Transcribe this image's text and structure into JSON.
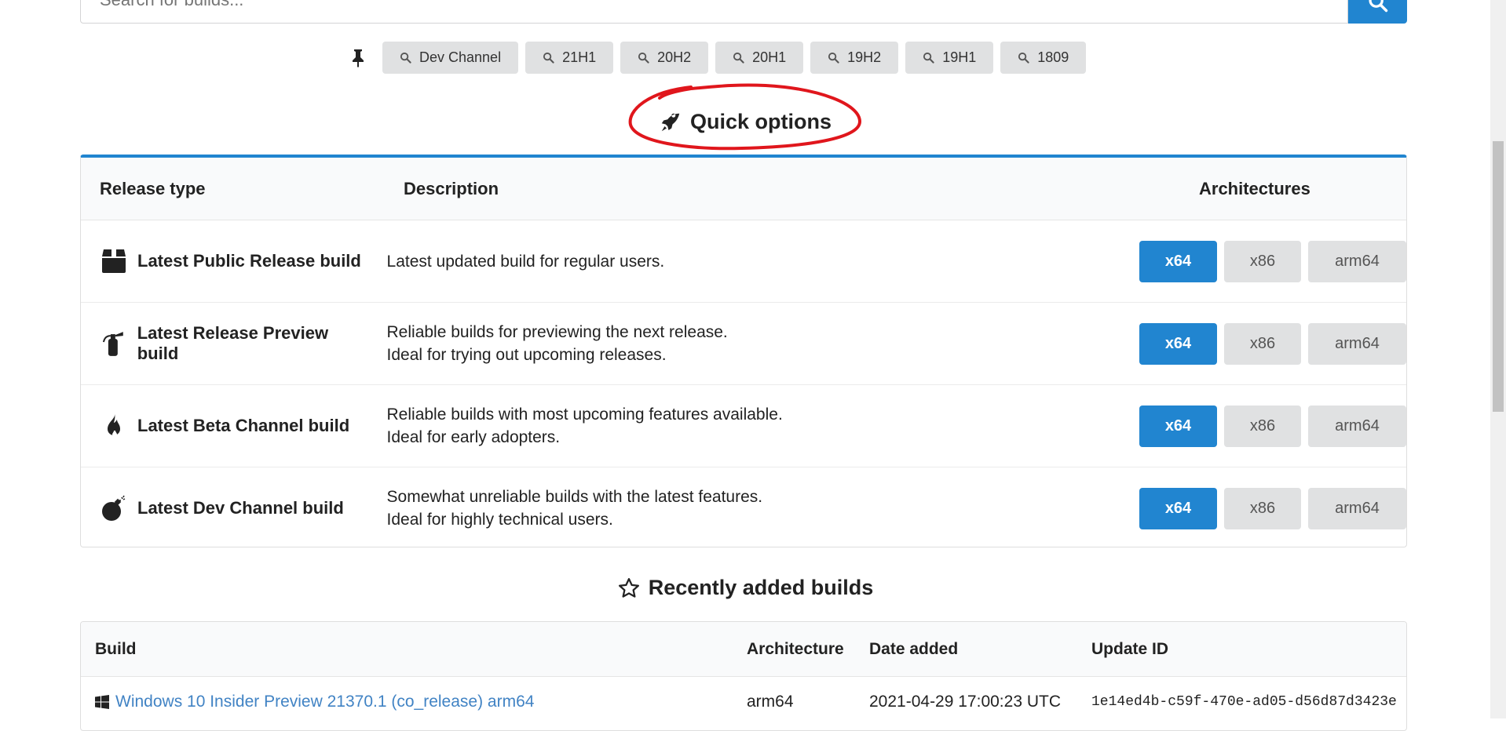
{
  "search": {
    "placeholder": "Search for builds..."
  },
  "tags": [
    "Dev Channel",
    "21H1",
    "20H2",
    "20H1",
    "19H2",
    "19H1",
    "1809"
  ],
  "quick_options": {
    "title": "Quick options",
    "columns": [
      "Release type",
      "Description",
      "Architectures"
    ],
    "rows": [
      {
        "name": "Latest Public Release build",
        "icon": "box-icon",
        "desc1": "Latest updated build for regular users.",
        "desc2": "",
        "archs": [
          "x64",
          "x86",
          "arm64"
        ]
      },
      {
        "name": "Latest Release Preview build",
        "icon": "fire-extinguisher-icon",
        "desc1": "Reliable builds for previewing the next release.",
        "desc2": "Ideal for trying out upcoming releases.",
        "archs": [
          "x64",
          "x86",
          "arm64"
        ]
      },
      {
        "name": "Latest Beta Channel build",
        "icon": "fire-icon",
        "desc1": "Reliable builds with most upcoming features available.",
        "desc2": "Ideal for early adopters.",
        "archs": [
          "x64",
          "x86",
          "arm64"
        ]
      },
      {
        "name": "Latest Dev Channel build",
        "icon": "bomb-icon",
        "desc1": "Somewhat unreliable builds with the latest features.",
        "desc2": "Ideal for highly technical users.",
        "archs": [
          "x64",
          "x86",
          "arm64"
        ]
      }
    ]
  },
  "recent": {
    "title": "Recently added builds",
    "columns": [
      "Build",
      "Architecture",
      "Date added",
      "Update ID"
    ],
    "rows": [
      {
        "build": "Windows 10 Insider Preview 21370.1 (co_release) arm64",
        "arch": "arm64",
        "date": "2021-04-29 17:00:23 UTC",
        "id": "1e14ed4b-c59f-470e-ad05-d56d87d3423e"
      }
    ]
  },
  "colors": {
    "primary": "#2185d0",
    "link": "#4183c4",
    "annotation": "#e0161c"
  }
}
